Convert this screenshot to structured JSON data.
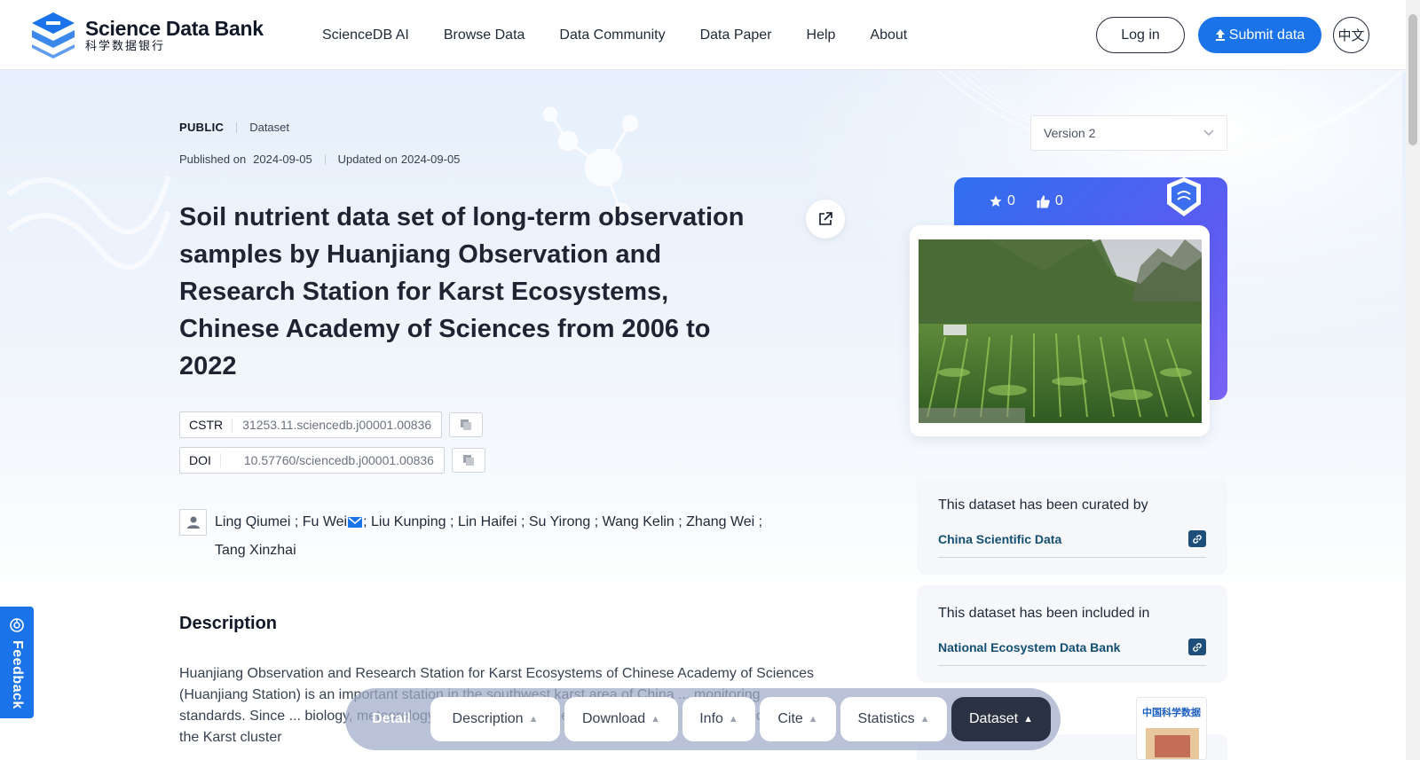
{
  "header": {
    "logo_en": "Science Data Bank",
    "logo_cn": "科学数据银行",
    "nav": [
      "ScienceDB AI",
      "Browse Data",
      "Data Community",
      "Data Paper",
      "Help",
      "About"
    ],
    "login_label": "Log in",
    "submit_label": "Submit data",
    "lang_label": "中文"
  },
  "dataset": {
    "access": "PUBLIC",
    "type": "Dataset",
    "published_label": "Published on",
    "published_date": "2024-09-05",
    "updated_label": "Updated on",
    "updated_date": "2024-09-05",
    "title": "Soil nutrient data set of long-term observation samples by Huanjiang Observation and Research Station for Karst Ecosystems, Chinese Academy of Sciences from 2006 to 2022",
    "cstr_label": "CSTR",
    "cstr_value": "31253.11.sciencedb.j00001.00836",
    "doi_label": "DOI",
    "doi_value": "10.57760/sciencedb.j00001.00836",
    "authors_before_mail": "Ling Qiumei ; Fu Wei",
    "authors_after_mail": "; Liu Kunping ; Lin Haifei ; Su Yirong ; Wang Kelin ; Zhang Wei ;",
    "authors_line2": "Tang Xinzhai",
    "description_heading": "Description",
    "description_text": " Huanjiang Observation and Research Station for Karst Ecosystems of Chinese Academy of Sciences (Huanjiang Station) is an important station in the southwest karst area of China ... monitoring standards. Since ... biology, meteorology and other environmental factors of the farmland ecosystem in the Karst cluster"
  },
  "sidebar": {
    "version": "Version 2",
    "stars": "0",
    "likes": "0",
    "curated_text": "This dataset has been curated by",
    "curated_link": "China Scientific Data",
    "included_text": "This dataset has been included in",
    "included_link": "National Ecosystem Data Bank",
    "journal_title": "中国科学数据"
  },
  "feedback_label": "Feedback",
  "bottom_nav": {
    "detail": "Detail",
    "items": [
      "Description",
      "Download",
      "Info",
      "Cite",
      "Statistics",
      "Dataset"
    ],
    "active": "Dataset"
  },
  "colors": {
    "primary": "#1a73e8",
    "link": "#134f73",
    "active_tab": "#2b3243"
  }
}
